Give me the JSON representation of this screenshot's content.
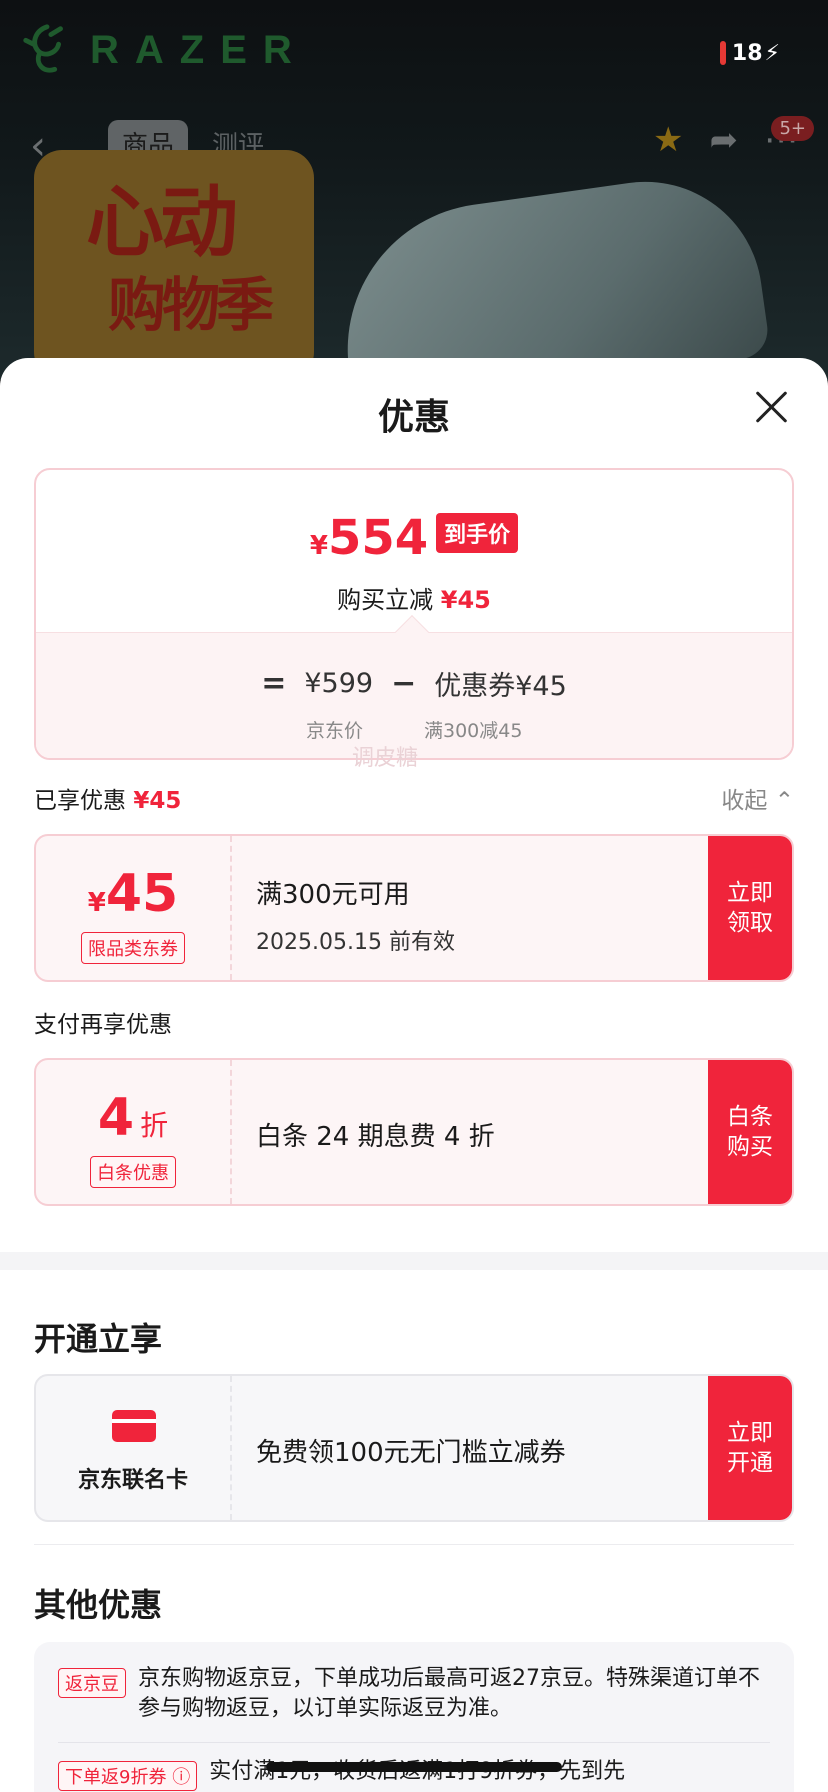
{
  "background_page": {
    "brand_logo": "RAZER",
    "status": {
      "badge_value": "18"
    },
    "nav": {
      "back_icon": "chevron-left-icon",
      "tabs": [
        "商品",
        "测评"
      ],
      "active_tab": "商品",
      "icons": [
        "star-icon",
        "share-icon",
        "more-icon"
      ],
      "message_count": "5+"
    },
    "promo_art_text": {
      "line1": "心动",
      "line2": "购物季"
    }
  },
  "sheet": {
    "title": "优惠",
    "summary": {
      "currency": "¥",
      "final_price": "554",
      "final_tag": "到手价",
      "instant_label": "购买立减",
      "instant_amount": "¥45",
      "equals": "=",
      "jd_price": "¥599",
      "minus": "−",
      "coupon_part": "优惠券¥45",
      "jd_price_label": "京东价",
      "coupon_rule": "满300减45"
    },
    "enjoyed": {
      "label": "已享优惠",
      "amount": "¥45",
      "collapse_label": "收起"
    },
    "coupon": {
      "currency": "¥",
      "value": "45",
      "tag": "限品类东券",
      "condition": "满300元可用",
      "expiry": "2025.05.15 前有效",
      "action": "立即领取"
    },
    "watermark": "调皮糖",
    "payment": {
      "label": "支付再享优惠",
      "value": "4",
      "unit": "折",
      "tag": "白条优惠",
      "desc": "白条 24 期息费 4 折",
      "action": "白条购买"
    },
    "open": {
      "heading": "开通立享",
      "card_label": "京东联名卡",
      "desc": "免费领100元无门槛立减券",
      "action": "立即开通"
    },
    "other": {
      "heading": "其他优惠",
      "items": [
        {
          "badge": "返京豆",
          "text": "京东购物返京豆，下单成功后最高可返27京豆。特殊渠道订单不参与购物返豆，以订单实际返豆为准。"
        },
        {
          "badge": "下单返9折券",
          "text": "实付满1元，收货后返满1打9折券，先到先"
        }
      ]
    }
  },
  "colors": {
    "accent": "#f0243b",
    "coupon_bg": "#fdf5f6",
    "coupon_border": "#f6cdd3"
  }
}
